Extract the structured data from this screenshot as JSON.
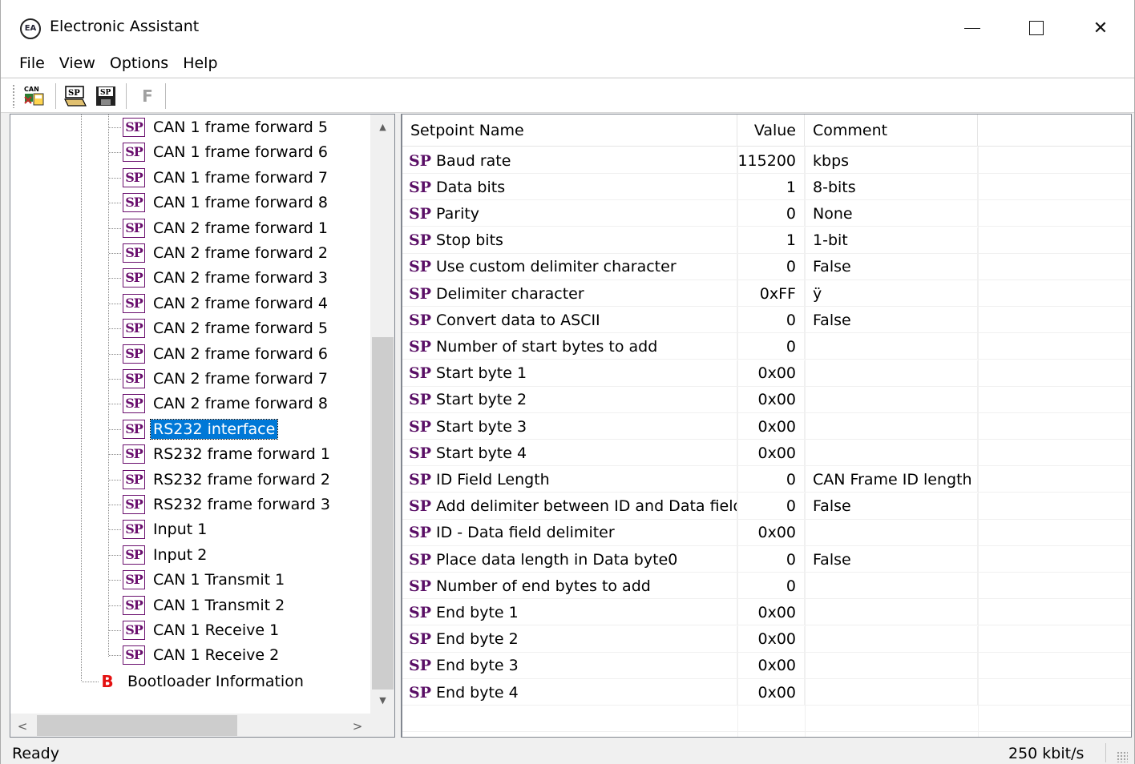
{
  "window": {
    "title": "Electronic Assistant",
    "icon_text": "EA",
    "minimize_icon": "minimize-icon",
    "maximize_icon": "maximize-icon",
    "close_icon": "close-icon",
    "close_glyph": "✕"
  },
  "menu": [
    "File",
    "View",
    "Options",
    "Help"
  ],
  "toolbar": {
    "can_label": "CAN",
    "sp_label": "SP",
    "disabled_label": "F"
  },
  "tree": {
    "sp_badge": "SP",
    "b_badge": "B",
    "items": [
      "CAN 1 frame forward 5",
      "CAN 1 frame forward 6",
      "CAN 1 frame forward 7",
      "CAN 1 frame forward 8",
      "CAN 2 frame forward 1",
      "CAN 2 frame forward 2",
      "CAN 2 frame forward 3",
      "CAN 2 frame forward 4",
      "CAN 2 frame forward 5",
      "CAN 2 frame forward 6",
      "CAN 2 frame forward 7",
      "CAN 2 frame forward 8",
      "RS232 interface",
      "RS232 frame forward 1",
      "RS232 frame forward 2",
      "RS232 frame forward 3",
      "Input 1",
      "Input 2",
      "CAN 1 Transmit 1",
      "CAN 1 Transmit 2",
      "CAN 1 Receive 1",
      "CAN 1 Receive 2"
    ],
    "selected_index": 12,
    "bootloader_label": "Bootloader Information",
    "scroll_up": "▲",
    "scroll_down": "▼",
    "scroll_left": "<",
    "scroll_right": ">"
  },
  "list": {
    "columns": [
      "Setpoint Name",
      "Value",
      "Comment"
    ],
    "prefix": "SP",
    "rows": [
      {
        "name": "Baud rate",
        "value": "115200",
        "comment": "kbps"
      },
      {
        "name": "Data bits",
        "value": "1",
        "comment": "8-bits"
      },
      {
        "name": "Parity",
        "value": "0",
        "comment": "None"
      },
      {
        "name": "Stop bits",
        "value": "1",
        "comment": "1-bit"
      },
      {
        "name": "Use custom delimiter character",
        "value": "0",
        "comment": "False"
      },
      {
        "name": "Delimiter character",
        "value": "0xFF",
        "comment": "ÿ"
      },
      {
        "name": "Convert data to ASCII",
        "value": "0",
        "comment": "False"
      },
      {
        "name": "Number of start bytes to add",
        "value": "0",
        "comment": ""
      },
      {
        "name": "Start byte 1",
        "value": "0x00",
        "comment": ""
      },
      {
        "name": "Start byte 2",
        "value": "0x00",
        "comment": ""
      },
      {
        "name": "Start byte 3",
        "value": "0x00",
        "comment": ""
      },
      {
        "name": "Start byte 4",
        "value": "0x00",
        "comment": ""
      },
      {
        "name": "ID Field Length",
        "value": "0",
        "comment": "CAN Frame ID length"
      },
      {
        "name": "Add delimiter between ID and Data fields",
        "value": "0",
        "comment": "False"
      },
      {
        "name": "ID - Data field delimiter",
        "value": "0x00",
        "comment": ""
      },
      {
        "name": "Place data length in Data byte0",
        "value": "0",
        "comment": "False"
      },
      {
        "name": "Number of end bytes to add",
        "value": "0",
        "comment": ""
      },
      {
        "name": "End byte 1",
        "value": "0x00",
        "comment": ""
      },
      {
        "name": "End byte 2",
        "value": "0x00",
        "comment": ""
      },
      {
        "name": "End byte 3",
        "value": "0x00",
        "comment": ""
      },
      {
        "name": "End byte 4",
        "value": "0x00",
        "comment": ""
      }
    ]
  },
  "status": {
    "left": "Ready",
    "right": "250 kbit/s"
  },
  "colors": {
    "selection": "#0078d7",
    "sp_purple": "#6a0f6e",
    "bootloader_red": "#e41111"
  }
}
